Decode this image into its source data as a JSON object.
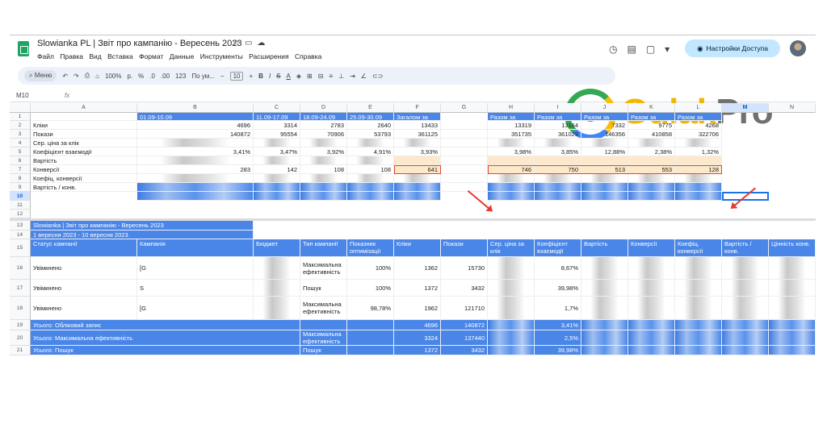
{
  "doc": {
    "title": "Slowianka PL | Звіт про кампанію - Вересень 2023",
    "title_icons": [
      "star-icon",
      "folder-icon",
      "cloud-icon"
    ],
    "menu": [
      "Файл",
      "Правка",
      "Вид",
      "Вставка",
      "Формат",
      "Данные",
      "Инструменты",
      "Расширения",
      "Справка"
    ],
    "access_button": "Настройки Доступа"
  },
  "toolbar": {
    "search": "Меню",
    "zoom": "100%",
    "currency": "р.",
    "percent": "%",
    "dec_less": ".0",
    "dec_more": ".00",
    "number_fmt": "123",
    "font": "По ум...",
    "font_size": "10",
    "buttons": [
      "B",
      "I",
      "S",
      "A"
    ]
  },
  "formula_bar": {
    "cell_ref": "M10",
    "fx": "fx"
  },
  "logo": {
    "part1": "Gulak",
    "part2": "Pro"
  },
  "columns": [
    "A",
    "B",
    "C",
    "D",
    "E",
    "F",
    "G",
    "H",
    "I",
    "J",
    "K",
    "L",
    "M",
    "N"
  ],
  "top_table": {
    "headers": {
      "B": "01.09-10.09",
      "C": "11.09-17.09",
      "D": "18.09-24.09",
      "E": "25.09-30.09",
      "F": "Загалом за Вересень",
      "H": "Разом за Серпень",
      "I": "Разом за Липень",
      "J": "Разом за Червень",
      "K": "Разом за Травень",
      "L": "Разом за Квітень"
    },
    "rows": [
      {
        "label": "Кліки",
        "values": [
          "4696",
          "3314",
          "2783",
          "2640",
          "13433",
          "",
          "13319",
          "13164",
          "7332",
          "9775",
          "4268"
        ]
      },
      {
        "label": "Покази",
        "values": [
          "140872",
          "95554",
          "70906",
          "53793",
          "361125",
          "",
          "351735",
          "361029",
          "146356",
          "410858",
          "322706"
        ]
      },
      {
        "label": "Сер. ціна за клік",
        "values": [
          "",
          "",
          "",
          "",
          "",
          "",
          "",
          "",
          "",
          "",
          ""
        ]
      },
      {
        "label": "Коефіцієнт взаємодії",
        "values": [
          "3,41%",
          "3,47%",
          "3,92%",
          "4,91%",
          "3,93%",
          "",
          "3,98%",
          "3,85%",
          "12,88%",
          "2,38%",
          "1,32%"
        ]
      },
      {
        "label": "Вартість",
        "values": [
          "",
          "",
          "",
          "",
          "",
          "",
          "",
          "",
          "",
          "",
          ""
        ]
      },
      {
        "label": "Конверсії",
        "values": [
          "283",
          "142",
          "108",
          "108",
          "641",
          "",
          "746",
          "750",
          "513",
          "553",
          "128"
        ]
      },
      {
        "label": "Коефіц. конверсії",
        "values": [
          "",
          "",
          "",
          "",
          "",
          "",
          "",
          "",
          "",
          "",
          ""
        ]
      },
      {
        "label": "Вартість / конв.",
        "values": [
          "",
          "",
          "",
          "",
          "",
          "",
          "",
          "",
          "",
          "",
          ""
        ]
      }
    ]
  },
  "report_header": {
    "title": "Slowianka | Звіт про кампанію - Вересень 2023",
    "range": "1 вересня 2023 - 10 вересня 2023"
  },
  "campaign_table": {
    "headers": [
      "Статус кампанії",
      "Кампанія",
      "Бюджет",
      "Тип кампанії",
      "Показник оптимізації",
      "Кліки",
      "Покази",
      "Сер. ціна за клік",
      "Коефіцієнт взаємодії",
      "Вартість",
      "Конверсії",
      "Коефіц. конверсії",
      "Вартість / конв.",
      "Цінність конв."
    ],
    "rows": [
      {
        "status": "Увімкнено",
        "campaign": "[G",
        "type": "Максимальна ефективність",
        "opt": "100%",
        "clicks": "1362",
        "impr": "15730",
        "ctr": "8,67%"
      },
      {
        "status": "Увімкнено",
        "campaign": "S",
        "type": "Пошук",
        "opt": "100%",
        "clicks": "1372",
        "impr": "3432",
        "ctr": "39,98%"
      },
      {
        "status": "Увімкнено",
        "campaign": "[G",
        "type": "Максимальна ефективність",
        "opt": "98,78%",
        "clicks": "1962",
        "impr": "121710",
        "ctr": "1,7%"
      }
    ],
    "totals": [
      {
        "label": "Усього: Обліковий запис",
        "type": "",
        "clicks": "4696",
        "impr": "140872",
        "ctr": "3,41%"
      },
      {
        "label": "Усього: Максимальна ефективність",
        "type": "Максимальна ефективність",
        "clicks": "3324",
        "impr": "137440",
        "ctr": "2,5%"
      },
      {
        "label": "Усього: Пошук",
        "type": "Пошук",
        "clicks": "1372",
        "impr": "3432",
        "ctr": "39,98%"
      }
    ]
  },
  "row_numbers": [
    "1",
    "2",
    "3",
    "4",
    "5",
    "6",
    "7",
    "8",
    "9",
    "10",
    "11",
    "12",
    "13",
    "14",
    "15",
    "16",
    "17",
    "18",
    "19",
    "20",
    "21"
  ],
  "colors": {
    "header_blue": "#4a86e8",
    "highlight": "#fde9c9",
    "annotation_red": "#ea4335",
    "selection": "#1a73e8"
  }
}
